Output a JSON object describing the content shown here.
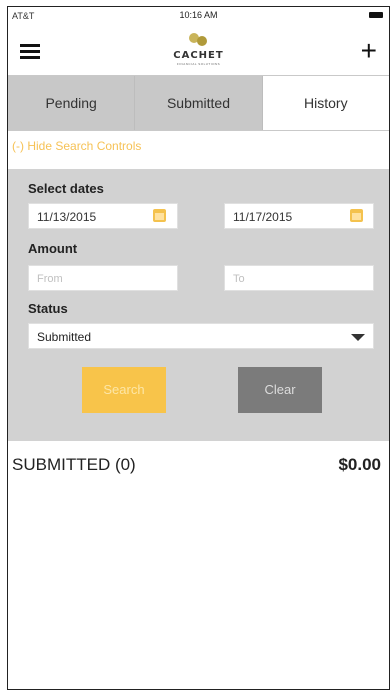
{
  "status_bar": {
    "carrier": "AT&T",
    "time": "10:16 AM"
  },
  "header": {
    "logo_text": "CACHET",
    "logo_tagline": "FINANCIAL SOLUTIONS",
    "menu_icon": "hamburger-menu-icon",
    "add_icon": "plus-icon"
  },
  "tabs": [
    {
      "label": "Pending"
    },
    {
      "label": "Submitted"
    },
    {
      "label": "History"
    }
  ],
  "active_tab": "History",
  "toggle_link": "(-) Hide Search Controls",
  "search": {
    "dates_label": "Select dates",
    "date_from": "11/13/2015",
    "date_to": "11/17/2015",
    "amount_label": "Amount",
    "amount_from_placeholder": "From",
    "amount_to_placeholder": "To",
    "status_label": "Status",
    "status_value": "Submitted",
    "search_button": "Search",
    "clear_button": "Clear"
  },
  "summary": {
    "name": "SUBMITTED (0)",
    "total": "$0.00"
  },
  "colors": {
    "accent": "#f8c44a",
    "panel_bg": "#d2d2d2",
    "tab_bg": "#c8c8c8",
    "clear_btn": "#7b7b7b"
  }
}
